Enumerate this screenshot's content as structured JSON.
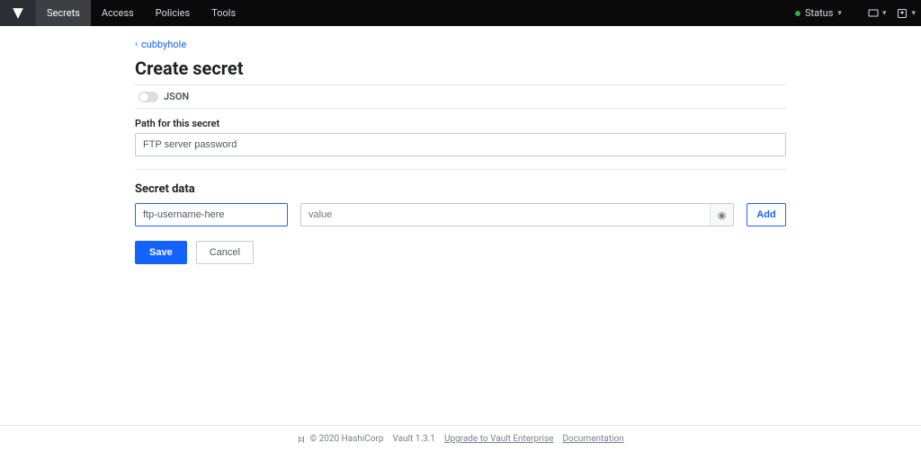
{
  "nav": {
    "tabs": [
      "Secrets",
      "Access",
      "Policies",
      "Tools"
    ],
    "active_tab": 0,
    "status_label": "Status"
  },
  "breadcrumb": {
    "back_label": "cubbyhole"
  },
  "page": {
    "title": "Create secret",
    "json_toggle_label": "JSON",
    "path_label": "Path for this secret",
    "path_value": "FTP server password",
    "secret_data_label": "Secret data",
    "kv": {
      "key_value": "ftp-username-here",
      "value_placeholder": "value"
    },
    "add_label": "Add",
    "save_label": "Save",
    "cancel_label": "Cancel"
  },
  "footer": {
    "copyright": "© 2020 HashiCorp",
    "version": "Vault 1.3.1",
    "upgrade": "Upgrade to Vault Enterprise",
    "docs": "Documentation"
  }
}
